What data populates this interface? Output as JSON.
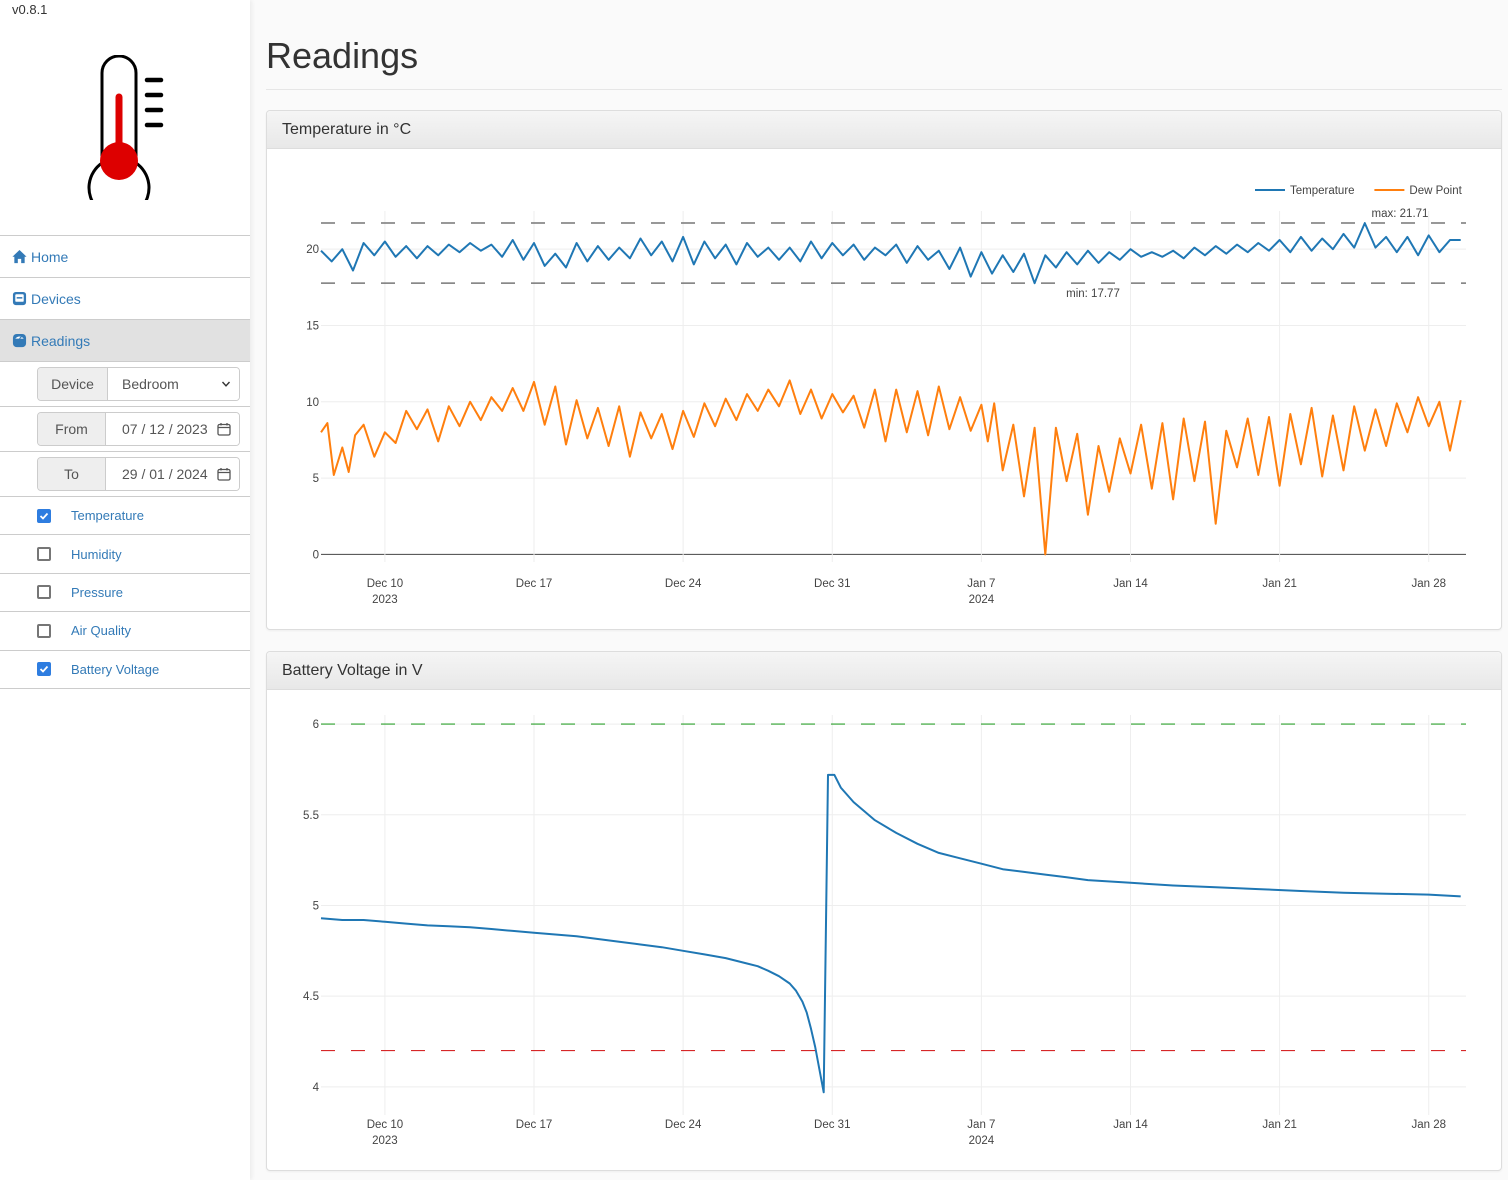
{
  "app": {
    "version": "v0.8.1",
    "logo_icon": "thermometer-icon"
  },
  "sidebar": {
    "nav": [
      {
        "label": "Home",
        "icon": "home-icon",
        "active": false
      },
      {
        "label": "Devices",
        "icon": "devices-icon",
        "active": false
      },
      {
        "label": "Readings",
        "icon": "readings-icon",
        "active": true
      }
    ],
    "device": {
      "label": "Device",
      "value": "Bedroom"
    },
    "from": {
      "label": "From",
      "value": "07 / 12 / 2023"
    },
    "to": {
      "label": "To",
      "value": "29 / 01 / 2024"
    },
    "metrics": [
      {
        "label": "Temperature",
        "checked": true
      },
      {
        "label": "Humidity",
        "checked": false
      },
      {
        "label": "Pressure",
        "checked": false
      },
      {
        "label": "Air Quality",
        "checked": false
      },
      {
        "label": "Battery Voltage",
        "checked": true
      }
    ]
  },
  "main": {
    "title": "Readings"
  },
  "chart_data": [
    {
      "type": "line",
      "title": "Temperature in °C",
      "xlabel": "",
      "ylabel": "",
      "x_range": [
        "2023-12-07",
        "2024-01-29T18:00"
      ],
      "ylim": [
        -0.5,
        22.5
      ],
      "yticks": [
        0,
        5,
        10,
        15,
        20
      ],
      "xticks": [
        {
          "date": "2023-12-10",
          "label": "Dec 10",
          "sub": "2023"
        },
        {
          "date": "2023-12-17",
          "label": "Dec 17",
          "sub": ""
        },
        {
          "date": "2023-12-24",
          "label": "Dec 24",
          "sub": ""
        },
        {
          "date": "2023-12-31",
          "label": "Dec 31",
          "sub": ""
        },
        {
          "date": "2024-01-07",
          "label": "Jan 7",
          "sub": "2024"
        },
        {
          "date": "2024-01-14",
          "label": "Jan 14",
          "sub": ""
        },
        {
          "date": "2024-01-21",
          "label": "Jan 21",
          "sub": ""
        },
        {
          "date": "2024-01-28",
          "label": "Jan 28",
          "sub": ""
        }
      ],
      "grid": true,
      "legend": "top-right",
      "annotations": [
        {
          "text": "max: 21.71",
          "value": 21.71,
          "line_color": "#777777"
        },
        {
          "text": "min: 17.77",
          "value": 17.77,
          "line_color": "#777777"
        }
      ],
      "series": [
        {
          "name": "Temperature",
          "color": "#1f77b4",
          "day_offsets": [
            0,
            0.5,
            1,
            1.5,
            2,
            2.5,
            3,
            3.5,
            4,
            4.5,
            5,
            5.5,
            6,
            6.5,
            7,
            7.5,
            8,
            8.5,
            9,
            9.5,
            10,
            10.5,
            11,
            11.5,
            12,
            12.5,
            13,
            13.5,
            14,
            14.5,
            15,
            15.5,
            16,
            16.5,
            17,
            17.5,
            18,
            18.5,
            19,
            19.5,
            20,
            20.5,
            21,
            21.5,
            22,
            22.5,
            23,
            23.5,
            24,
            24.5,
            25,
            25.5,
            26,
            26.5,
            27,
            27.5,
            28,
            28.5,
            29,
            29.5,
            30,
            30.5,
            31,
            31.5,
            32,
            32.5,
            33,
            33.5,
            34,
            34.5,
            35,
            35.5,
            36,
            36.5,
            37,
            37.5,
            38,
            38.5,
            39,
            39.5,
            40,
            40.5,
            41,
            41.5,
            42,
            42.5,
            43,
            43.5,
            44,
            44.5,
            45,
            45.5,
            46,
            46.5,
            47,
            47.5,
            48,
            48.5,
            49,
            49.5,
            50,
            50.5,
            51,
            51.5,
            52,
            52.5,
            53,
            53.5
          ],
          "values": [
            19.9,
            19.2,
            20.0,
            18.6,
            20.4,
            19.6,
            20.5,
            19.5,
            20.2,
            19.4,
            20.2,
            19.6,
            20.3,
            19.8,
            20.4,
            19.9,
            20.3,
            19.5,
            20.6,
            19.3,
            20.4,
            18.9,
            19.7,
            18.8,
            20.4,
            19.2,
            20.2,
            19.3,
            20.1,
            19.4,
            20.7,
            19.6,
            20.5,
            19.2,
            20.8,
            19.0,
            20.5,
            19.4,
            20.3,
            19.0,
            20.4,
            19.5,
            20.1,
            19.3,
            20.1,
            19.2,
            20.5,
            19.4,
            20.4,
            19.6,
            20.3,
            19.3,
            20.1,
            19.6,
            20.3,
            19.1,
            20.2,
            19.3,
            19.9,
            18.7,
            20.1,
            18.2,
            19.8,
            18.4,
            19.6,
            18.5,
            19.7,
            17.77,
            19.6,
            18.8,
            19.8,
            19.0,
            19.9,
            19.1,
            19.8,
            19.3,
            20.0,
            19.5,
            19.8,
            19.5,
            19.9,
            19.4,
            20.1,
            19.6,
            20.2,
            19.7,
            20.3,
            19.8,
            20.4,
            19.9,
            20.6,
            19.8,
            20.8,
            19.9,
            20.7,
            20.0,
            21.0,
            20.1,
            21.71,
            20.1,
            20.8,
            19.8,
            20.8,
            19.6,
            20.9,
            19.8,
            20.6,
            20.6
          ]
        },
        {
          "name": "Dew Point",
          "color": "#ff7f0e",
          "day_offsets": [
            0,
            0.3,
            0.6,
            1,
            1.3,
            1.6,
            2,
            2.5,
            3,
            3.5,
            4,
            4.5,
            5,
            5.5,
            6,
            6.5,
            7,
            7.5,
            8,
            8.5,
            9,
            9.5,
            10,
            10.5,
            11,
            11.5,
            12,
            12.5,
            13,
            13.5,
            14,
            14.5,
            15,
            15.5,
            16,
            16.5,
            17,
            17.5,
            18,
            18.5,
            19,
            19.5,
            20,
            20.5,
            21,
            21.5,
            22,
            22.5,
            23,
            23.5,
            24,
            24.5,
            25,
            25.5,
            26,
            26.5,
            27,
            27.5,
            28,
            28.5,
            29,
            29.5,
            30,
            30.5,
            31,
            31.3,
            31.6,
            32,
            32.5,
            33,
            33.5,
            34,
            34.5,
            35,
            35.5,
            36,
            36.5,
            37,
            37.5,
            38,
            38.5,
            39,
            39.5,
            40,
            40.5,
            41,
            41.5,
            42,
            42.5,
            43,
            43.5,
            44,
            44.5,
            45,
            45.5,
            46,
            46.5,
            47,
            47.5,
            48,
            48.5,
            49,
            49.5,
            50,
            50.5,
            51,
            51.5,
            52,
            52.5,
            53,
            53.5
          ],
          "values": [
            8.0,
            8.6,
            5.2,
            7.0,
            5.4,
            7.8,
            8.5,
            6.4,
            8.0,
            7.3,
            9.4,
            8.2,
            9.5,
            7.4,
            9.7,
            8.4,
            10.0,
            8.8,
            10.3,
            9.4,
            10.9,
            9.4,
            11.3,
            8.5,
            11.0,
            7.2,
            10.1,
            7.6,
            9.6,
            7.1,
            9.7,
            6.4,
            9.3,
            7.6,
            9.2,
            6.9,
            9.4,
            7.7,
            9.9,
            8.4,
            10.2,
            8.8,
            10.5,
            9.4,
            10.8,
            9.7,
            11.4,
            9.2,
            10.8,
            8.9,
            10.5,
            9.3,
            10.4,
            8.3,
            10.8,
            7.4,
            10.8,
            8.0,
            10.7,
            7.8,
            11.0,
            8.2,
            10.3,
            8.1,
            9.8,
            7.4,
            9.9,
            5.5,
            8.5,
            3.8,
            8.3,
            0.0,
            8.3,
            4.8,
            7.9,
            2.6,
            7.1,
            4.1,
            7.6,
            5.3,
            8.5,
            4.3,
            8.6,
            3.6,
            8.9,
            4.8,
            8.7,
            2.0,
            8.1,
            5.7,
            8.9,
            5.2,
            9.0,
            4.5,
            9.2,
            5.9,
            9.6,
            5.1,
            9.1,
            5.5,
            9.7,
            6.8,
            9.5,
            7.1,
            9.9,
            8.0,
            10.3,
            8.4,
            10.0,
            6.8,
            10.1,
            6.5,
            10.2,
            6.3,
            8.2
          ]
        }
      ]
    },
    {
      "type": "line",
      "title": "Battery Voltage in V",
      "xlabel": "",
      "ylabel": "",
      "x_range": [
        "2023-12-07",
        "2024-01-29T18:00"
      ],
      "ylim": [
        3.9,
        6.05
      ],
      "yticks": [
        4,
        4.5,
        5,
        5.5,
        6
      ],
      "xticks": [
        {
          "date": "2023-12-10",
          "label": "Dec 10",
          "sub": "2023"
        },
        {
          "date": "2023-12-17",
          "label": "Dec 17",
          "sub": ""
        },
        {
          "date": "2023-12-24",
          "label": "Dec 24",
          "sub": ""
        },
        {
          "date": "2023-12-31",
          "label": "Dec 31",
          "sub": ""
        },
        {
          "date": "2024-01-07",
          "label": "Jan 7",
          "sub": "2024"
        },
        {
          "date": "2024-01-14",
          "label": "Jan 14",
          "sub": ""
        },
        {
          "date": "2024-01-21",
          "label": "Jan 21",
          "sub": ""
        },
        {
          "date": "2024-01-28",
          "label": "Jan 28",
          "sub": ""
        }
      ],
      "grid": true,
      "legend": "none",
      "thresholds": [
        {
          "value": 6.0,
          "color": "#2ca02c"
        },
        {
          "value": 4.2,
          "color": "#d62728"
        }
      ],
      "series": [
        {
          "name": "Battery Voltage",
          "color": "#1f77b4",
          "day_offsets": [
            0,
            1,
            2,
            3,
            4,
            5,
            6,
            7,
            8,
            9,
            10,
            11,
            12,
            13,
            14,
            15,
            16,
            17,
            18,
            19,
            20,
            20.5,
            21,
            21.5,
            22,
            22.3,
            22.6,
            22.8,
            23.0,
            23.2,
            23.6,
            23.8,
            24.1,
            24.4,
            25,
            25.5,
            26,
            27,
            28,
            29,
            30,
            31,
            32,
            33,
            34,
            35,
            36,
            38,
            40,
            42,
            44,
            46,
            48,
            50,
            52,
            53.5
          ],
          "values": [
            4.93,
            4.92,
            4.92,
            4.91,
            4.9,
            4.89,
            4.885,
            4.88,
            4.87,
            4.86,
            4.85,
            4.84,
            4.83,
            4.815,
            4.8,
            4.785,
            4.77,
            4.75,
            4.73,
            4.71,
            4.68,
            4.665,
            4.64,
            4.61,
            4.57,
            4.53,
            4.47,
            4.41,
            4.32,
            4.22,
            3.97,
            5.72,
            5.72,
            5.65,
            5.57,
            5.52,
            5.47,
            5.4,
            5.34,
            5.29,
            5.26,
            5.23,
            5.2,
            5.185,
            5.17,
            5.155,
            5.14,
            5.125,
            5.11,
            5.1,
            5.09,
            5.08,
            5.07,
            5.065,
            5.06,
            5.05
          ]
        }
      ]
    }
  ]
}
